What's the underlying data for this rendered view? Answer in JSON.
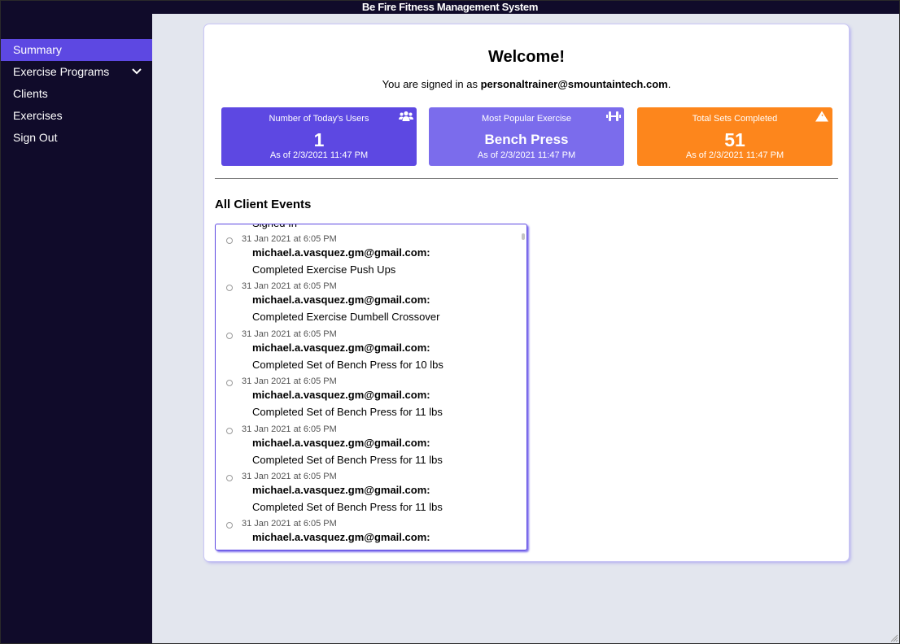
{
  "window": {
    "title": "Be Fire Fitness Management System"
  },
  "sidebar": {
    "items": [
      {
        "label": "Summary",
        "active": true
      },
      {
        "label": "Exercise Programs",
        "icon": "chevron-down-icon"
      },
      {
        "label": "Clients"
      },
      {
        "label": "Exercises"
      },
      {
        "label": "Sign Out"
      }
    ]
  },
  "main": {
    "welcome": "Welcome!",
    "signed_in_prefix": "You are signed in as ",
    "signed_in_email": "personaltrainer@smountaintech.com",
    "signed_in_suffix": ".",
    "stats": [
      {
        "title": "Number of Today's Users",
        "value": "1",
        "date": "As of 2/3/2021 11:47 PM",
        "icon": "users-icon",
        "color": "#5d48e2"
      },
      {
        "title": "Most Popular Exercise",
        "value": "Bench Press",
        "date": "As of 2/3/2021 11:47 PM",
        "icon": "dumbbell-icon",
        "color": "#7b6cec"
      },
      {
        "title": "Total Sets Completed",
        "value": "51",
        "date": "As of 2/3/2021 11:47 PM",
        "icon": "warning-icon",
        "color": "#fd861c"
      }
    ],
    "events_title": "All Client Events",
    "events_partial_top": "Signed In",
    "events": [
      {
        "time": "31 Jan 2021 at 6:05 PM",
        "user": "michael.a.vasquez.gm@gmail.com:",
        "action": "Completed Exercise Push Ups"
      },
      {
        "time": "31 Jan 2021 at 6:05 PM",
        "user": "michael.a.vasquez.gm@gmail.com:",
        "action": "Completed Exercise Dumbell Crossover"
      },
      {
        "time": "31 Jan 2021 at 6:05 PM",
        "user": "michael.a.vasquez.gm@gmail.com:",
        "action": "Completed Set of Bench Press for 10 lbs"
      },
      {
        "time": "31 Jan 2021 at 6:05 PM",
        "user": "michael.a.vasquez.gm@gmail.com:",
        "action": "Completed Set of Bench Press for 11 lbs"
      },
      {
        "time": "31 Jan 2021 at 6:05 PM",
        "user": "michael.a.vasquez.gm@gmail.com:",
        "action": "Completed Set of Bench Press for 11 lbs"
      },
      {
        "time": "31 Jan 2021 at 6:05 PM",
        "user": "michael.a.vasquez.gm@gmail.com:",
        "action": "Completed Set of Bench Press for 11 lbs"
      },
      {
        "time": "31 Jan 2021 at 6:05 PM",
        "user": "michael.a.vasquez.gm@gmail.com:",
        "action": ""
      }
    ]
  },
  "colors": {
    "sidebar_bg": "#100b2a",
    "accent": "#5d48e2",
    "accent_light": "#7b6cec",
    "orange": "#fd861c",
    "page_bg": "#e3e6ee"
  }
}
